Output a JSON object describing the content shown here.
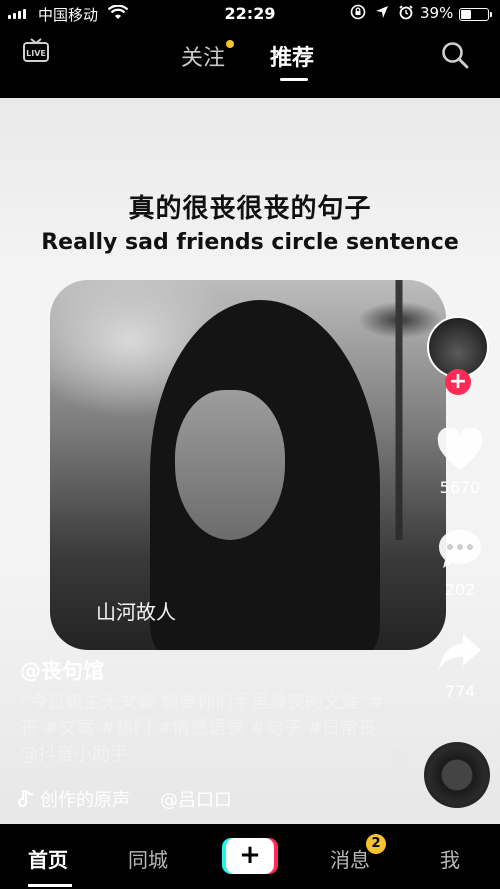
{
  "status_bar": {
    "carrier": "中国移动",
    "time": "22:29",
    "battery": "39%",
    "battery_level": 0.39
  },
  "top_nav": {
    "live_label": "LIVE",
    "tab_follow": "关注",
    "tab_recommend": "推荐"
  },
  "video": {
    "title": "真的很丧很丧的句子",
    "subtitle": "Really sad friends circle sentence",
    "photo_caption": "山河故人",
    "likes": "5670",
    "comments": "202",
    "shares": "774"
  },
  "post": {
    "username": "@丧句馆",
    "description": "“今日馆主无文案 想要你们手里最丧的文案”#丧 #文案 #热门 #情感语录 #句子 #日常丧@抖音小助手",
    "music": "创作的原声",
    "music_author": "@吕口口"
  },
  "bottom_nav": {
    "home": "首页",
    "city": "同城",
    "messages": "消息",
    "messages_badge": "2",
    "me": "我",
    "plus": "+"
  },
  "colors": {
    "accent_red": "#fe2c55",
    "accent_cyan": "#25f4ee",
    "badge_yellow": "#f7c42d"
  },
  "icons": [
    "signal-icon",
    "wifi-icon",
    "lock-rotation-icon",
    "location-icon",
    "alarm-icon",
    "battery-icon",
    "live-icon",
    "search-icon",
    "heart-icon",
    "comment-icon",
    "share-icon",
    "music-note-icon",
    "music-disc-icon"
  ]
}
